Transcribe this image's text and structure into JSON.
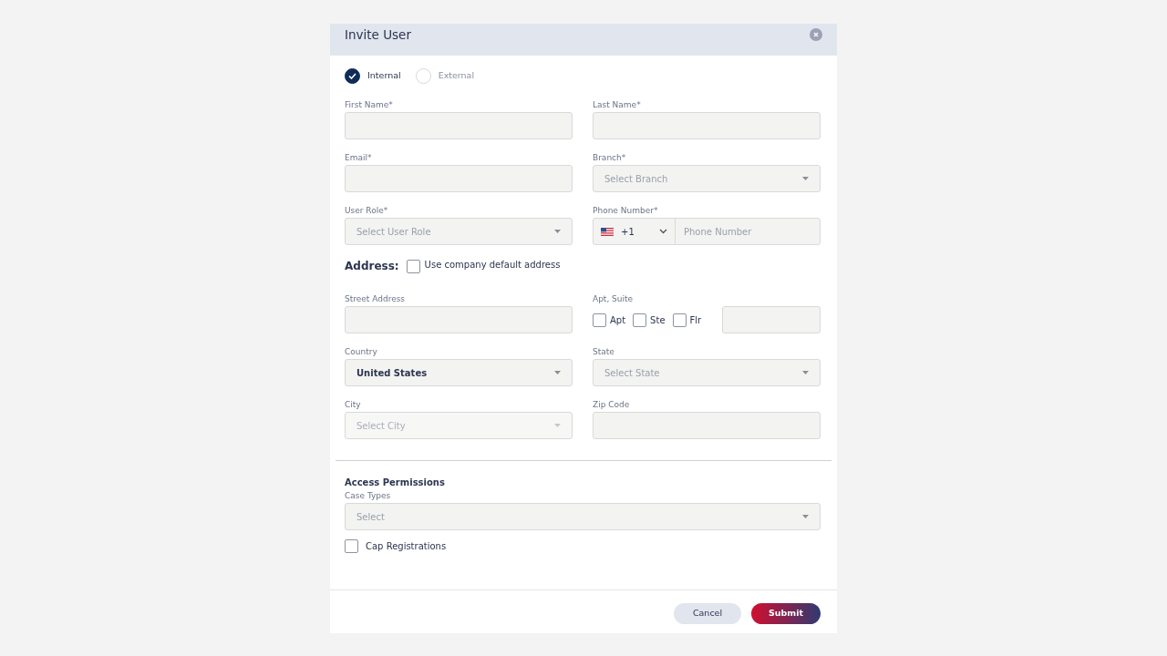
{
  "dialog": {
    "title": "Invite User"
  },
  "user_type": [
    {
      "label": "Internal",
      "selected": true
    },
    {
      "label": "External",
      "selected": false
    }
  ],
  "fields": [
    {
      "kind": "text",
      "label": "First Name*"
    },
    {
      "kind": "text",
      "label": "Last Name*"
    },
    {
      "kind": "text",
      "label": "Email*"
    },
    {
      "kind": "select",
      "label": "Branch*",
      "placeholder": "Select Branch",
      "disabled": false
    },
    {
      "kind": "select",
      "label": "User Role*",
      "placeholder": "Select User Role",
      "disabled": false
    },
    {
      "kind": "phone",
      "label": "Phone Number*",
      "code": "+1",
      "placeholder": "Phone Number"
    }
  ],
  "address": {
    "label": "Address:",
    "default_option": {
      "label": "Use company default address",
      "checked": false
    }
  },
  "address_fields": [
    {
      "kind": "text",
      "label": "Street Address"
    },
    {
      "kind": "apt",
      "label": "Apt, Suite",
      "options": [
        {
          "label": "Apt",
          "checked": false
        },
        {
          "label": "Ste",
          "checked": false
        },
        {
          "label": "Flr",
          "checked": false
        }
      ]
    },
    {
      "kind": "select",
      "label": "Country",
      "value": "United States",
      "disabled": false
    },
    {
      "kind": "select",
      "label": "State",
      "placeholder": "Select State",
      "disabled": false
    },
    {
      "kind": "select",
      "label": "City",
      "placeholder": "Select City",
      "disabled": true
    },
    {
      "kind": "text",
      "label": "Zip Code"
    }
  ],
  "access": {
    "title": "Access Permissions",
    "case_types": {
      "label": "Case Types",
      "placeholder": "Select"
    },
    "cap_registrations": {
      "label": "Cap Registrations",
      "checked": false
    }
  },
  "buttons": [
    {
      "label": "Cancel",
      "kind": "secondary"
    },
    {
      "label": "Submit",
      "kind": "primary"
    }
  ]
}
